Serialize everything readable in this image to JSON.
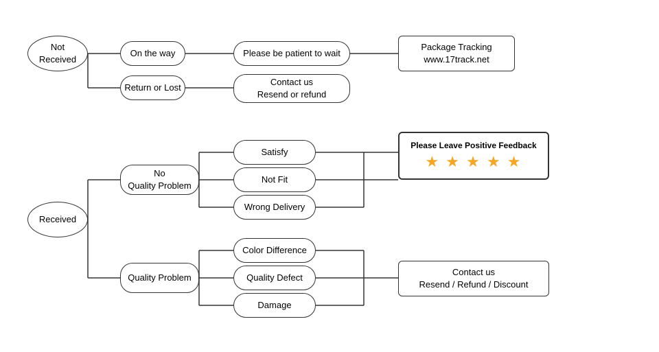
{
  "nodes": {
    "not_received": {
      "label": "Not\nReceived"
    },
    "on_the_way": {
      "label": "On the way"
    },
    "please_wait": {
      "label": "Please be patient to wait"
    },
    "package_tracking": {
      "label": "Package Tracking\nwww.17track.net"
    },
    "return_or_lost": {
      "label": "Return or Lost"
    },
    "contact_resend_refund": {
      "label": "Contact us\nResend or refund"
    },
    "received": {
      "label": "Received"
    },
    "no_quality_problem": {
      "label": "No\nQuality Problem"
    },
    "satisfy": {
      "label": "Satisfy"
    },
    "not_fit": {
      "label": "Not Fit"
    },
    "wrong_delivery": {
      "label": "Wrong Delivery"
    },
    "quality_problem": {
      "label": "Quality Problem"
    },
    "color_difference": {
      "label": "Color Difference"
    },
    "quality_defect": {
      "label": "Quality Defect"
    },
    "damage": {
      "label": "Damage"
    },
    "positive_feedback": {
      "label": "Please Leave Positive Feedback"
    },
    "stars": {
      "label": "★ ★ ★ ★ ★"
    },
    "contact_resend_refund_discount": {
      "label": "Contact us\nResend / Refund / Discount"
    }
  }
}
